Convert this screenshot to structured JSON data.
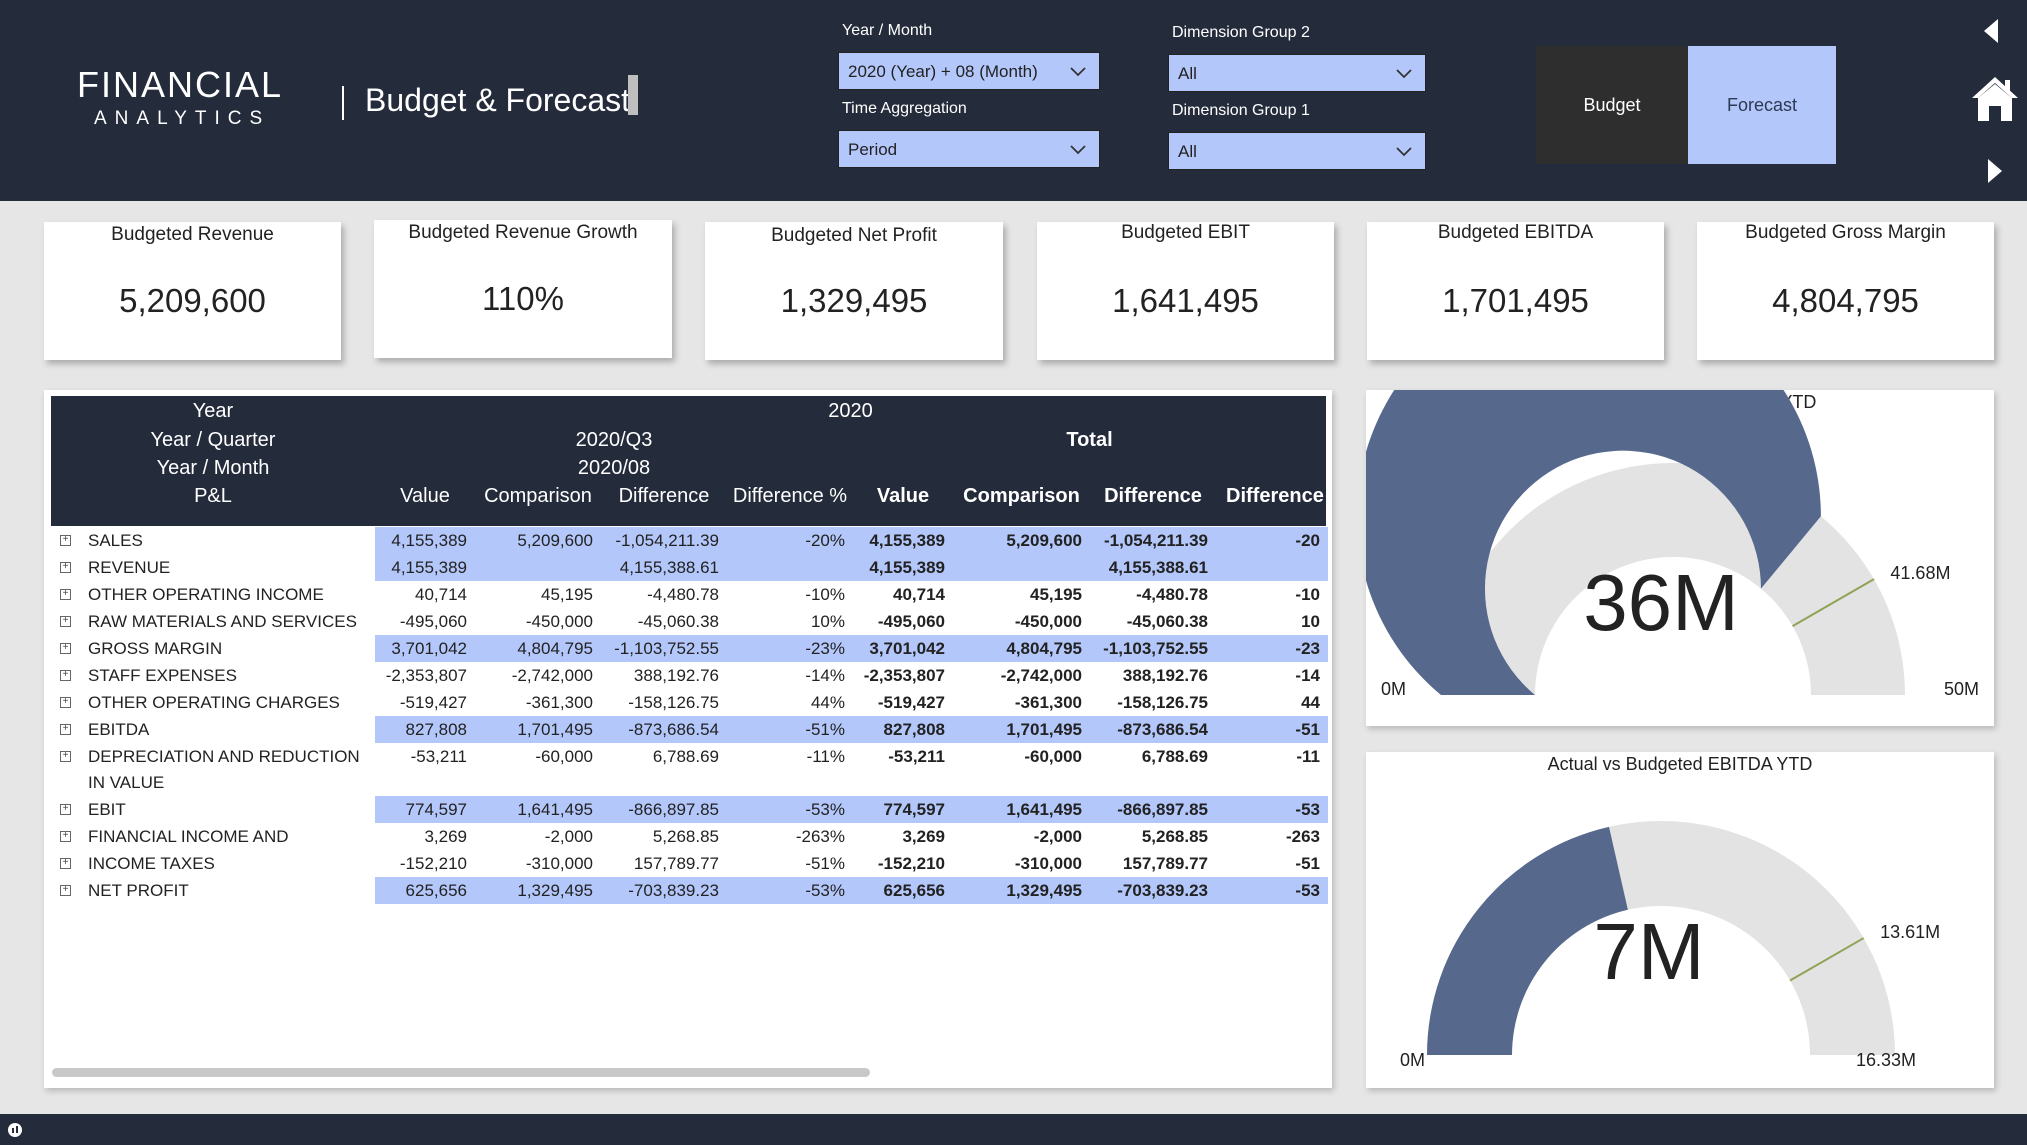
{
  "header": {
    "logo_main": "FINANCIAL",
    "logo_sub": "ANALYTICS",
    "page_title": "Budget & Forecast"
  },
  "filters": {
    "year_month": {
      "label": "Year / Month",
      "value": "2020 (Year) + 08 (Month)"
    },
    "time_aggregation": {
      "label": "Time Aggregation",
      "value": "Period"
    },
    "dimension_group_2": {
      "label": "Dimension Group 2",
      "value": "All"
    },
    "dimension_group_1": {
      "label": "Dimension Group 1",
      "value": "All"
    }
  },
  "toggle": {
    "budget": "Budget",
    "forecast": "Forecast"
  },
  "kpis": [
    {
      "label": "Budgeted Revenue",
      "value": "5,209,600"
    },
    {
      "label": "Budgeted Revenue Growth",
      "value": "110%"
    },
    {
      "label": "Budgeted Net Profit",
      "value": "1,329,495"
    },
    {
      "label": "Budgeted EBIT",
      "value": "1,641,495"
    },
    {
      "label": "Budgeted EBITDA",
      "value": "1,701,495"
    },
    {
      "label": "Budgeted Gross Margin",
      "value": "4,804,795"
    }
  ],
  "matrix": {
    "header": {
      "year_label": "Year",
      "year_value": "2020",
      "quarter_label": "Year / Quarter",
      "quarter_value": "2020/Q3",
      "month_label": "Year / Month",
      "month_value": "2020/08",
      "total_label": "Total",
      "pl_label": "P&L",
      "columns": [
        "Value",
        "Comparison",
        "Difference",
        "Difference %",
        "Value",
        "Comparison",
        "Difference",
        "Difference"
      ]
    },
    "rows": [
      {
        "label": "SALES",
        "hl": true,
        "cells": [
          "4,155,389",
          "5,209,600",
          "-1,054,211.39",
          "-20%",
          "4,155,389",
          "5,209,600",
          "-1,054,211.39",
          "-20"
        ]
      },
      {
        "label": "REVENUE",
        "hl": true,
        "cells": [
          "4,155,389",
          "",
          "4,155,388.61",
          "",
          "4,155,389",
          "",
          "4,155,388.61",
          ""
        ]
      },
      {
        "label": "OTHER OPERATING INCOME",
        "hl": false,
        "cells": [
          "40,714",
          "45,195",
          "-4,480.78",
          "-10%",
          "40,714",
          "45,195",
          "-4,480.78",
          "-10"
        ]
      },
      {
        "label": "RAW MATERIALS AND SERVICES",
        "hl": false,
        "cells": [
          "-495,060",
          "-450,000",
          "-45,060.38",
          "10%",
          "-495,060",
          "-450,000",
          "-45,060.38",
          "10"
        ]
      },
      {
        "label": "GROSS MARGIN",
        "hl": true,
        "cells": [
          "3,701,042",
          "4,804,795",
          "-1,103,752.55",
          "-23%",
          "3,701,042",
          "4,804,795",
          "-1,103,752.55",
          "-23"
        ]
      },
      {
        "label": "STAFF EXPENSES",
        "hl": false,
        "cells": [
          "-2,353,807",
          "-2,742,000",
          "388,192.76",
          "-14%",
          "-2,353,807",
          "-2,742,000",
          "388,192.76",
          "-14"
        ]
      },
      {
        "label": "OTHER OPERATING CHARGES",
        "hl": false,
        "cells": [
          "-519,427",
          "-361,300",
          "-158,126.75",
          "44%",
          "-519,427",
          "-361,300",
          "-158,126.75",
          "44"
        ]
      },
      {
        "label": "EBITDA",
        "hl": true,
        "cells": [
          "827,808",
          "1,701,495",
          "-873,686.54",
          "-51%",
          "827,808",
          "1,701,495",
          "-873,686.54",
          "-51"
        ]
      },
      {
        "label": "DEPRECIATION AND REDUCTION",
        "label2": "IN VALUE",
        "hl": false,
        "cells": [
          "-53,211",
          "-60,000",
          "6,788.69",
          "-11%",
          "-53,211",
          "-60,000",
          "6,788.69",
          "-11"
        ]
      },
      {
        "label": "EBIT",
        "hl": true,
        "cells": [
          "774,597",
          "1,641,495",
          "-866,897.85",
          "-53%",
          "774,597",
          "1,641,495",
          "-866,897.85",
          "-53"
        ]
      },
      {
        "label": "FINANCIAL INCOME AND",
        "hl": false,
        "cells": [
          "3,269",
          "-2,000",
          "5,268.85",
          "-263%",
          "3,269",
          "-2,000",
          "5,268.85",
          "-263"
        ]
      },
      {
        "label": "INCOME TAXES",
        "hl": false,
        "cells": [
          "-152,210",
          "-310,000",
          "157,789.77",
          "-51%",
          "-152,210",
          "-310,000",
          "157,789.77",
          "-51"
        ]
      },
      {
        "label": "NET PROFIT",
        "hl": true,
        "cells": [
          "625,656",
          "1,329,495",
          "-703,839.23",
          "-53%",
          "625,656",
          "1,329,495",
          "-703,839.23",
          "-53"
        ]
      }
    ]
  },
  "gauges": [
    {
      "title": "Actual vs Budgeted Revenue YTD",
      "value": 36,
      "value_label": "36M",
      "min": 0,
      "min_label": "0M",
      "max": 50,
      "max_label": "50M",
      "target": 41.68,
      "target_label": "41.68M"
    },
    {
      "title": "Actual vs Budgeted EBITDA YTD",
      "value": 7,
      "value_label": "7M",
      "min": 0,
      "min_label": "0M",
      "max": 16.33,
      "max_label": "16.33M",
      "target": 13.61,
      "target_label": "13.61M"
    }
  ],
  "colors": {
    "navy": "#242b3b",
    "accent": "#b3c7fa",
    "gauge_fill": "#56688c",
    "gauge_track": "#e3e3e3",
    "target": "#8fa356"
  }
}
